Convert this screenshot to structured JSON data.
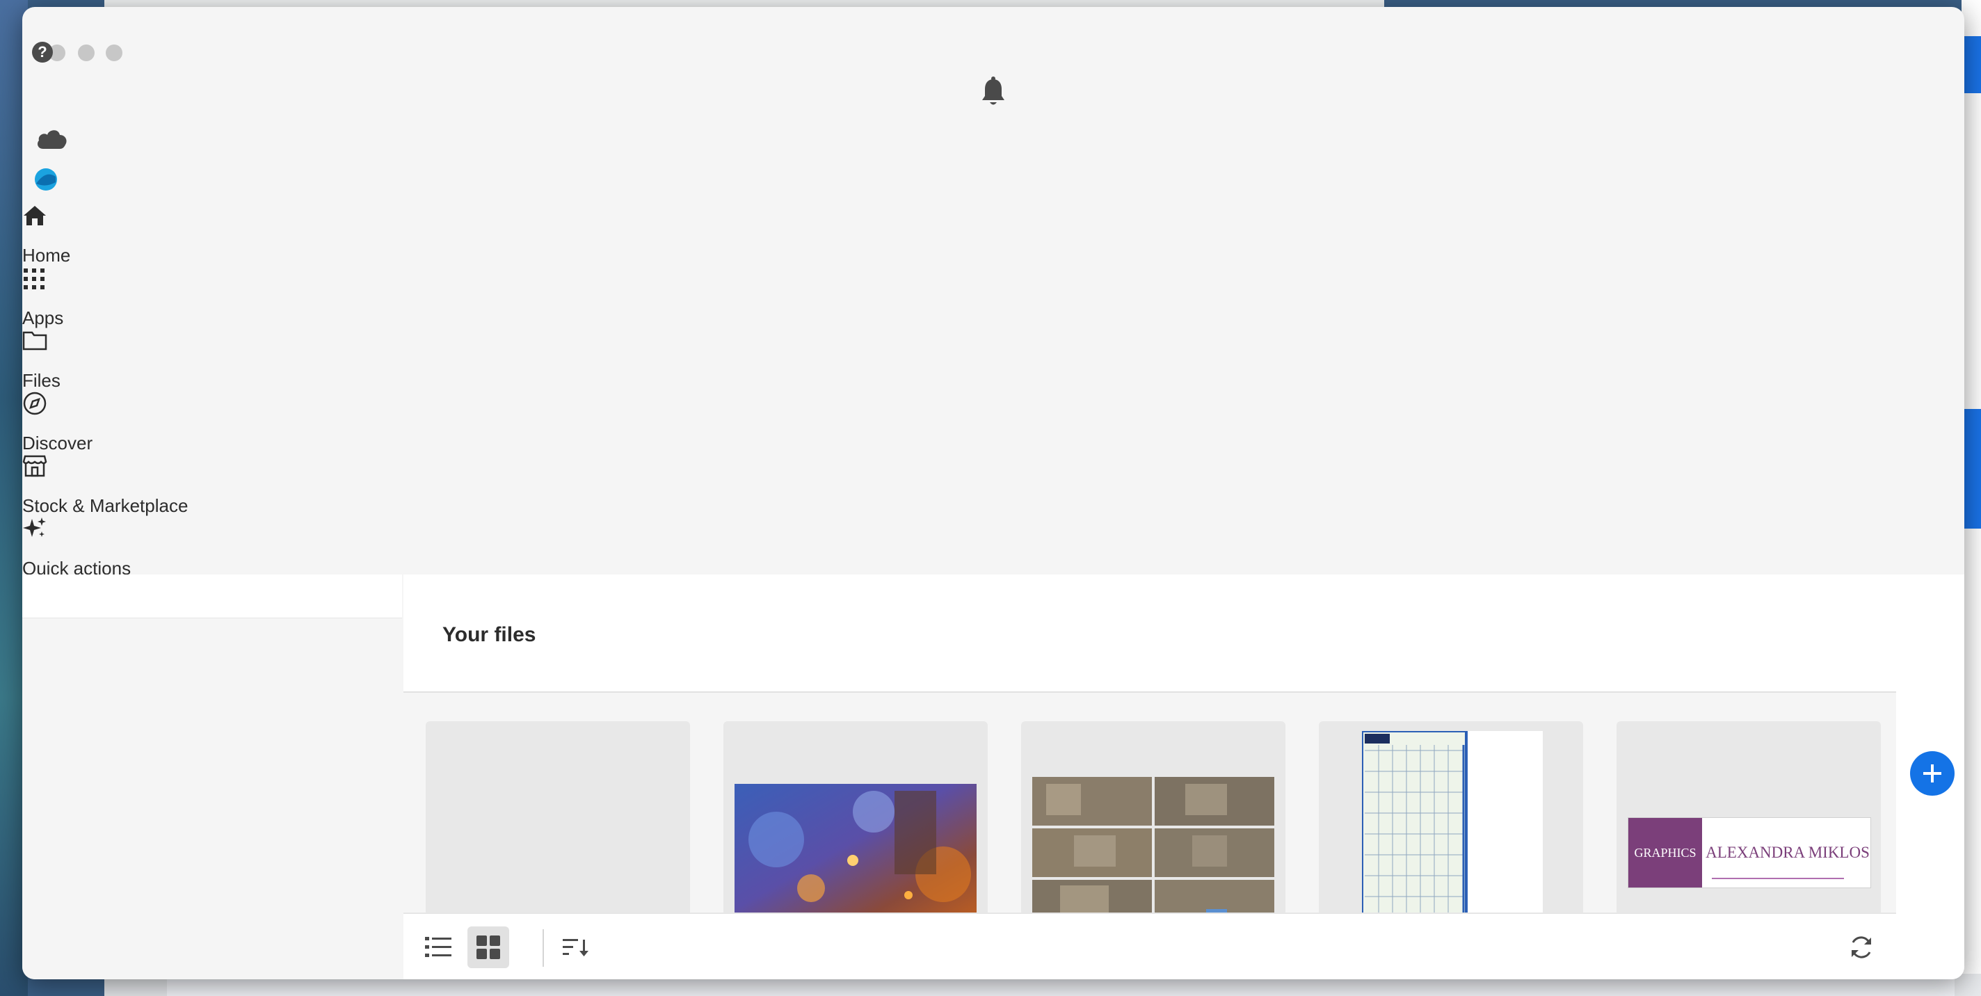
{
  "window": {
    "help_label": "?",
    "nav": [
      {
        "id": "home",
        "label": "Home",
        "icon": "home-icon"
      },
      {
        "id": "apps",
        "label": "Apps",
        "icon": "apps-grid-icon"
      },
      {
        "id": "files",
        "label": "Files",
        "icon": "folder-icon"
      },
      {
        "id": "discover",
        "label": "Discover",
        "icon": "compass-icon"
      },
      {
        "id": "stock",
        "label": "Stock & Marketplace",
        "icon": "storefront-icon"
      },
      {
        "id": "quick",
        "label": "Quick actions",
        "icon": "sparkle-icon"
      }
    ]
  },
  "content": {
    "title": "Your files",
    "cards": [
      {
        "type": "empty"
      },
      {
        "type": "fantasy-scene"
      },
      {
        "type": "interior-grid"
      },
      {
        "type": "calendar"
      },
      {
        "type": "business-card",
        "left_text": "GRAPHICS",
        "right_text": "ALEXANDRA MIKLOS"
      }
    ]
  },
  "toolbar": {
    "list_view": "list-view-icon",
    "grid_view": "grid-view-icon",
    "sort": "sort-icon",
    "refresh": "refresh-icon",
    "active_view": "grid"
  },
  "colors": {
    "accent": "#1473e6",
    "window_bg": "#f5f5f5",
    "card_bg": "#e8e8e8",
    "business_purple": "#7b3f7a"
  }
}
